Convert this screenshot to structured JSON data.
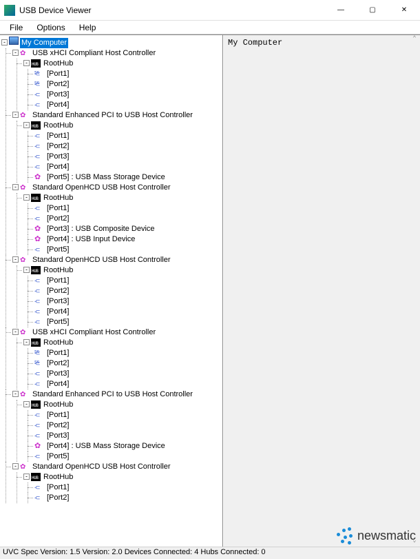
{
  "window": {
    "title": "USB Device Viewer",
    "controls": {
      "min": "—",
      "max": "▢",
      "close": "✕"
    }
  },
  "menu": {
    "file": "File",
    "options": "Options",
    "help": "Help"
  },
  "detail": {
    "text": "My Computer"
  },
  "statusbar": "UVC Spec Version: 1.5 Version: 2.0 Devices Connected: 4   Hubs Connected: 0",
  "watermark": "newsmatic",
  "tree": {
    "root": "My Computer",
    "controllers": [
      {
        "name": "USB xHCI Compliant Host Controller",
        "hub": "RootHub",
        "ports": [
          {
            "label": "[Port1]",
            "ss": true
          },
          {
            "label": "[Port2]",
            "ss": true
          },
          {
            "label": "[Port3]"
          },
          {
            "label": "[Port4]"
          }
        ]
      },
      {
        "name": "Standard Enhanced PCI to USB Host Controller",
        "hub": "RootHub",
        "ports": [
          {
            "label": "[Port1]"
          },
          {
            "label": "[Port2]"
          },
          {
            "label": "[Port3]"
          },
          {
            "label": "[Port4]"
          },
          {
            "label": "[Port5]  :  USB Mass Storage Device",
            "dev": true
          }
        ]
      },
      {
        "name": "Standard OpenHCD USB Host Controller",
        "hub": "RootHub",
        "ports": [
          {
            "label": "[Port1]"
          },
          {
            "label": "[Port2]"
          },
          {
            "label": "[Port3]  :  USB Composite Device",
            "dev": true
          },
          {
            "label": "[Port4]  :  USB Input Device",
            "dev": true
          },
          {
            "label": "[Port5]"
          }
        ]
      },
      {
        "name": "Standard OpenHCD USB Host Controller",
        "hub": "RootHub",
        "ports": [
          {
            "label": "[Port1]"
          },
          {
            "label": "[Port2]"
          },
          {
            "label": "[Port3]"
          },
          {
            "label": "[Port4]"
          },
          {
            "label": "[Port5]"
          }
        ]
      },
      {
        "name": "USB xHCI Compliant Host Controller",
        "hub": "RootHub",
        "ports": [
          {
            "label": "[Port1]",
            "ss": true
          },
          {
            "label": "[Port2]",
            "ss": true
          },
          {
            "label": "[Port3]"
          },
          {
            "label": "[Port4]"
          }
        ]
      },
      {
        "name": "Standard Enhanced PCI to USB Host Controller",
        "hub": "RootHub",
        "ports": [
          {
            "label": "[Port1]"
          },
          {
            "label": "[Port2]"
          },
          {
            "label": "[Port3]"
          },
          {
            "label": "[Port4]  :  USB Mass Storage Device",
            "dev": true
          },
          {
            "label": "[Port5]"
          }
        ]
      },
      {
        "name": "Standard OpenHCD USB Host Controller",
        "hub": "RootHub",
        "ports": [
          {
            "label": "[Port1]"
          },
          {
            "label": "[Port2]"
          }
        ]
      }
    ]
  }
}
